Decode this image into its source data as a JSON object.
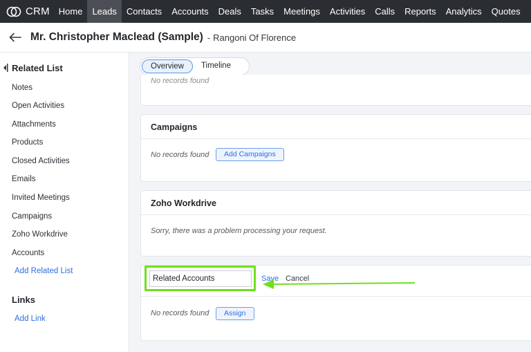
{
  "app": {
    "name": "CRM"
  },
  "nav": {
    "items": [
      "Home",
      "Leads",
      "Contacts",
      "Accounts",
      "Deals",
      "Tasks",
      "Meetings",
      "Activities",
      "Calls",
      "Reports",
      "Analytics",
      "Quotes"
    ],
    "active": "Leads",
    "more_label": "•••"
  },
  "record": {
    "title": "Mr. Christopher Maclead (Sample)",
    "separator": "-",
    "subtitle": "Rangoni Of Florence"
  },
  "sidebar": {
    "heading": "Related List",
    "items": [
      "Notes",
      "Open Activities",
      "Attachments",
      "Products",
      "Closed Activities",
      "Emails",
      "Invited Meetings",
      "Campaigns",
      "Zoho Workdrive",
      "Accounts"
    ],
    "add_related_label": "Add Related List",
    "links_heading": "Links",
    "add_link_label": "Add Link"
  },
  "view_toggle": {
    "overview": "Overview",
    "timeline": "Timeline",
    "selected": "Overview"
  },
  "sections": {
    "top_partial": {
      "empty_text": "No records found"
    },
    "campaigns": {
      "title": "Campaigns",
      "empty_text": "No records found",
      "button": "Add Campaigns"
    },
    "workdrive": {
      "title": "Zoho Workdrive",
      "error_text": "Sorry, there was a problem processing your request."
    },
    "accounts": {
      "input_value": "Related Accounts",
      "save_label": "Save",
      "cancel_label": "Cancel",
      "empty_text": "No records found",
      "button": "Assign"
    }
  },
  "colors": {
    "nav_bg": "#2a2d31",
    "link_blue": "#2f6fdc",
    "highlight_green": "#6ee01c"
  }
}
